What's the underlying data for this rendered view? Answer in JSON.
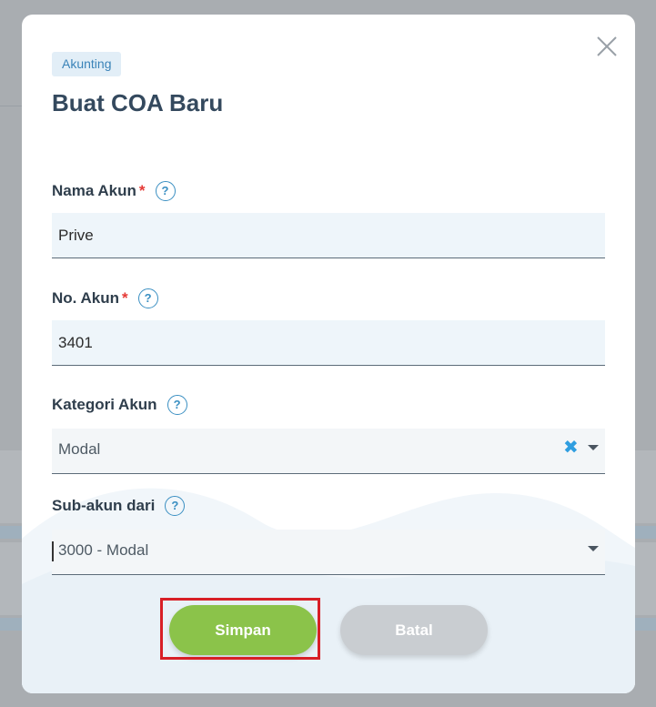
{
  "modal": {
    "tag": "Akunting",
    "title": "Buat COA Baru",
    "close_icon": "close-icon"
  },
  "fields": {
    "account_name": {
      "label": "Nama Akun",
      "required_mark": "*",
      "help_icon": "?",
      "value": "Prive"
    },
    "account_no": {
      "label": "No. Akun",
      "required_mark": "*",
      "help_icon": "?",
      "value": "3401"
    },
    "category": {
      "label": "Kategori Akun",
      "help_icon": "?",
      "selected": "Modal",
      "clear_icon": "✖"
    },
    "parent_account": {
      "label": "Sub-akun dari",
      "help_icon": "?",
      "selected": "3000 - Modal"
    }
  },
  "buttons": {
    "save_label": "Simpan",
    "cancel_label": "Batal"
  },
  "colors": {
    "primary_green": "#8bc34a",
    "secondary_gray": "#c9cdd1",
    "accent_blue": "#3a8fc2",
    "required_red": "#e53935",
    "highlight_red": "#d81f26"
  }
}
